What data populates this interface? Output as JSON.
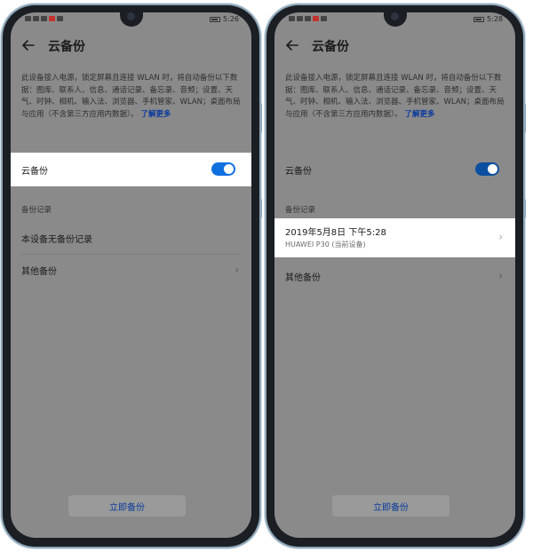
{
  "left": {
    "status": {
      "time": "5:26"
    },
    "header": {
      "title": "云备份"
    },
    "description": {
      "text": "此设备接入电源，锁定屏幕且连接 WLAN 时，将自动备份以下数据：图库、联系人、信息、通话记录、备忘录、音频；设置、天气、时钟、相机、输入法、浏览器、手机管家、WLAN；桌面布局与应用（不含第三方应用内数据）。",
      "learn_more": "了解更多"
    },
    "cloud_backup": {
      "label": "云备份",
      "enabled": true
    },
    "records": {
      "header": "备份记录",
      "empty_text": "本设备无备份记录",
      "other": "其他备份"
    },
    "backup_button": "立即备份"
  },
  "right": {
    "status": {
      "time": "5:28"
    },
    "header": {
      "title": "云备份"
    },
    "description": {
      "text": "此设备接入电源，锁定屏幕且连接 WLAN 时，将自动备份以下数据：图库、联系人、信息、通话记录、备忘录、音频；设置、天气、时钟、相机、输入法、浏览器、手机管家、WLAN；桌面布局与应用（不含第三方应用内数据）。",
      "learn_more": "了解更多"
    },
    "cloud_backup": {
      "label": "云备份",
      "enabled": true
    },
    "records": {
      "header": "备份记录",
      "item": {
        "date": "2019年5月8日 下午5:28",
        "device": "HUAWEI P30 (当前设备)"
      },
      "other": "其他备份"
    },
    "backup_button": "立即备份"
  },
  "colors": {
    "accent": "#1170e0",
    "link": "#0a3a9c",
    "dim_overlay": "#8a8a8a"
  },
  "icons": [
    "back-arrow-icon",
    "chevron-right-icon",
    "battery-icon",
    "wifi-icon"
  ]
}
